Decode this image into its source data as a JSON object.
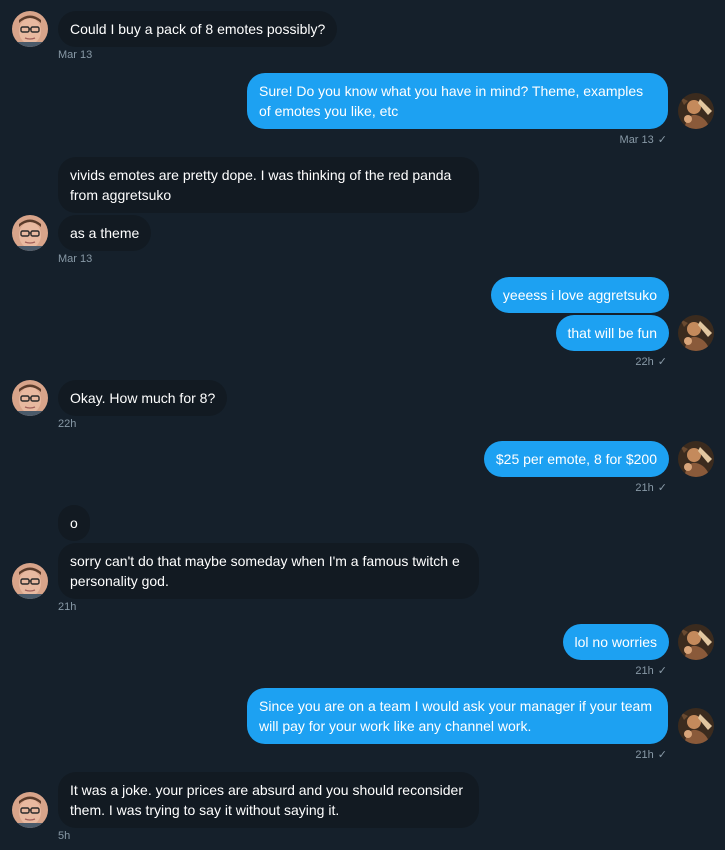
{
  "colors": {
    "background": "#15202b",
    "incoming_bubble": "#121a22",
    "outgoing_bubble": "#1da1f2",
    "timestamp": "#8899a6"
  },
  "icons": {
    "sent_check": "✓"
  },
  "messages": [
    {
      "id": "m1",
      "dir": "in",
      "text": "Could I buy a pack of 8 emotes possibly?"
    },
    {
      "id": "m2",
      "dir": "out",
      "text": "Sure! Do you know what you have in mind? Theme, examples of emotes you like, etc"
    },
    {
      "id": "m3",
      "dir": "in",
      "text": "vivids emotes are pretty dope. I was thinking of the red panda from aggretsuko"
    },
    {
      "id": "m4",
      "dir": "in",
      "text": "as a theme"
    },
    {
      "id": "m5",
      "dir": "out",
      "text": "yeeess i love aggretsuko"
    },
    {
      "id": "m6",
      "dir": "out",
      "text": "that will be fun"
    },
    {
      "id": "m7",
      "dir": "in",
      "text": "Okay. How much for 8?"
    },
    {
      "id": "m8",
      "dir": "out",
      "text": "$25 per emote, 8 for $200"
    },
    {
      "id": "m9",
      "dir": "in",
      "text": "o"
    },
    {
      "id": "m10",
      "dir": "in",
      "text": "sorry can't do that maybe someday when I'm a famous twitch e personality god."
    },
    {
      "id": "m11",
      "dir": "out",
      "text": "lol no worries"
    },
    {
      "id": "m12",
      "dir": "out",
      "text": "Since you are on a team I would ask your manager if your team will pay for your work like any channel work."
    },
    {
      "id": "m13",
      "dir": "in",
      "text": "It was a joke. your prices are absurd and you should reconsider them. I was trying to say it without saying it."
    }
  ],
  "timestamps": [
    {
      "id": "t1",
      "text": "Mar 13"
    },
    {
      "id": "t2",
      "text": "Mar 13"
    },
    {
      "id": "t3",
      "text": "Mar 13"
    },
    {
      "id": "t4",
      "text": "22h"
    },
    {
      "id": "t5",
      "text": "22h"
    },
    {
      "id": "t6",
      "text": "21h"
    },
    {
      "id": "t7",
      "text": "21h"
    },
    {
      "id": "t8",
      "text": "21h"
    },
    {
      "id": "t9",
      "text": "21h"
    },
    {
      "id": "t10",
      "text": "5h"
    }
  ]
}
